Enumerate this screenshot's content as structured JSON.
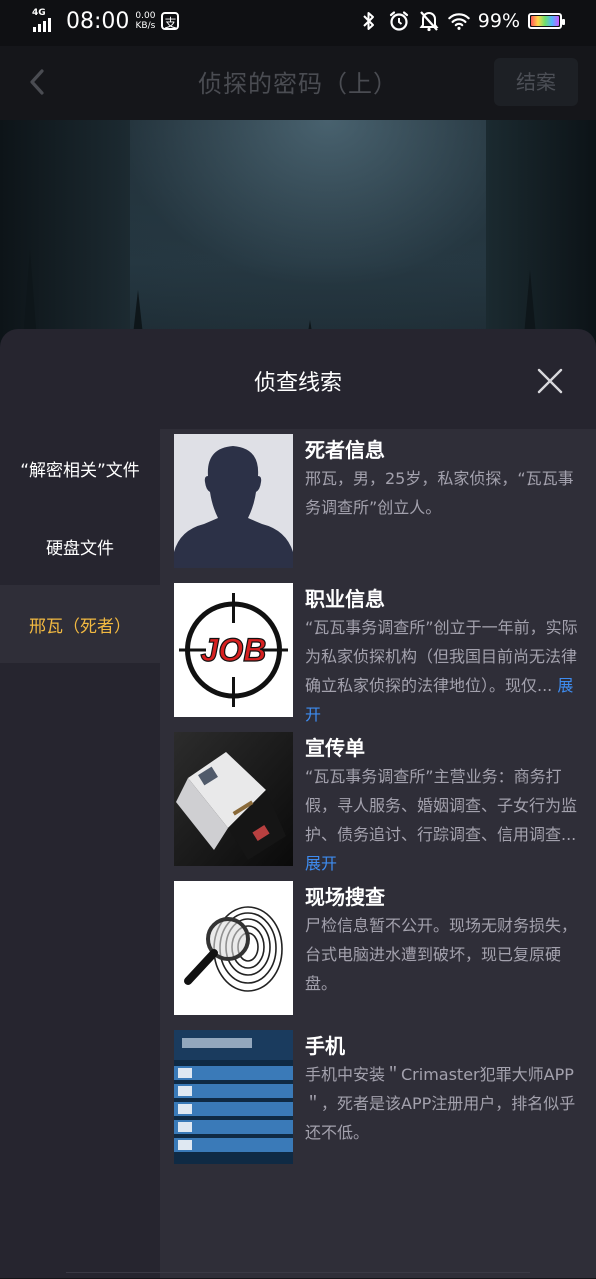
{
  "status_bar": {
    "network": "4G",
    "time": "08:00",
    "speed_value": "0.00",
    "speed_unit": "KB/s",
    "app_icon_glyph": "支",
    "battery_percent": "99%",
    "battery_level": 0.99
  },
  "header": {
    "title": "侦探的密码（上）",
    "close_case_label": "结案"
  },
  "sheet": {
    "title": "侦查线索",
    "categories": [
      {
        "label": "“解密相关”文件"
      },
      {
        "label": "硬盘文件"
      },
      {
        "label": "邢瓦（死者）"
      }
    ],
    "active_category": "邢瓦（死者）",
    "clues": [
      {
        "title": "死者信息",
        "desc": "邢瓦，男，25岁，私家侦探，“瓦瓦事务调查所”创立人。",
        "expand": "",
        "thumb_icon": "silhouette-image"
      },
      {
        "title": "职业信息",
        "desc": "“瓦瓦事务调查所”创立于一年前，实际为私家侦探机构（但我国目前尚无法律确立私家侦探的法律地位）。现仅...",
        "expand": "展开",
        "thumb_icon": "job-crosshair-image",
        "thumb_text": "JOB"
      },
      {
        "title": "宣传单",
        "desc": "“瓦瓦事务调查所”主营业务：商务打假，寻人服务、婚姻调查、子女行为监护、债务追讨、行踪调查、信用调查...",
        "expand": "展开",
        "thumb_icon": "brochure-image"
      },
      {
        "title": "现场搜查",
        "desc": "尸检信息暂不公开。现场无财务损失，台式电脑进水遭到破坏，现已复原硬盘。",
        "expand": "",
        "thumb_icon": "fingerprint-magnifier-image"
      },
      {
        "title": "手机",
        "desc": "手机中安装＂Crimaster犯罪大师APP＂，死者是该APP注册用户，排名似乎还不低。",
        "expand": "",
        "thumb_icon": "app-screenshot-image"
      }
    ]
  }
}
